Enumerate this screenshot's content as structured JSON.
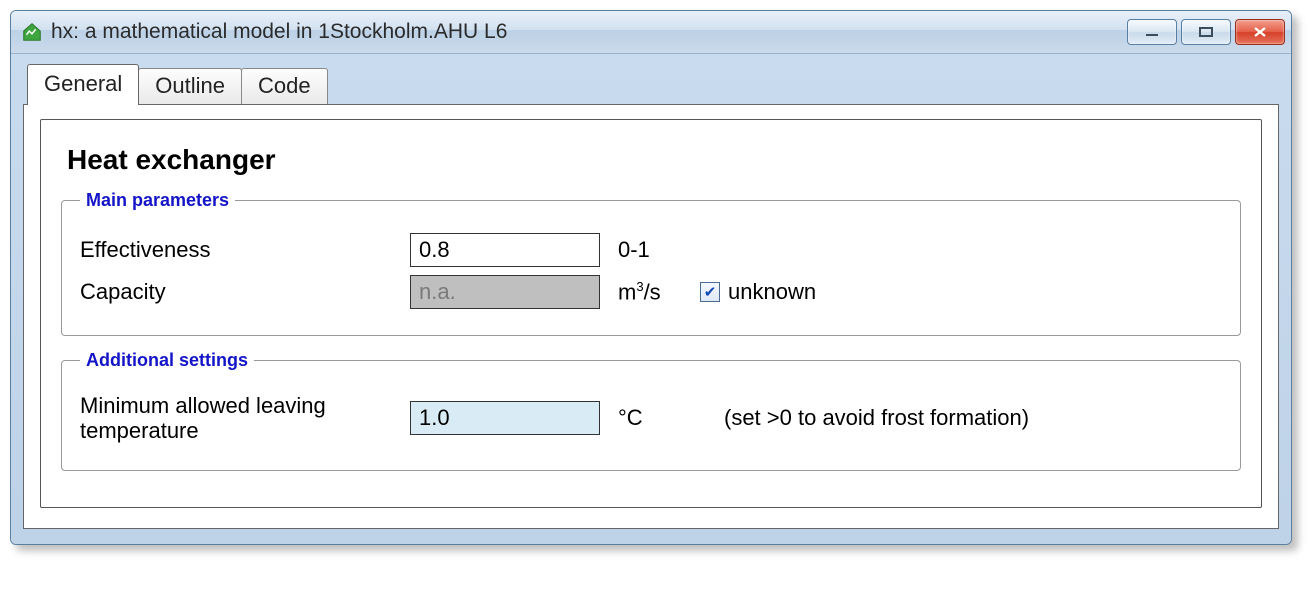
{
  "window": {
    "title": "hx: a mathematical model in 1Stockholm.AHU L6"
  },
  "tabs": [
    {
      "label": "General",
      "active": true
    },
    {
      "label": "Outline",
      "active": false
    },
    {
      "label": "Code",
      "active": false
    }
  ],
  "form": {
    "heading": "Heat exchanger",
    "main": {
      "legend": "Main parameters",
      "effectiveness": {
        "label": "Effectiveness",
        "value": "0.8",
        "unit": "0-1"
      },
      "capacity": {
        "label": "Capacity",
        "value": "n.a.",
        "unit_html": "m³/s",
        "unknown_label": "unknown",
        "unknown_checked": true
      }
    },
    "additional": {
      "legend": "Additional settings",
      "min_leaving_temp": {
        "label": "Minimum allowed leaving temperature",
        "value": "1.0",
        "unit": "°C",
        "hint": "(set >0 to avoid frost formation)"
      }
    }
  }
}
